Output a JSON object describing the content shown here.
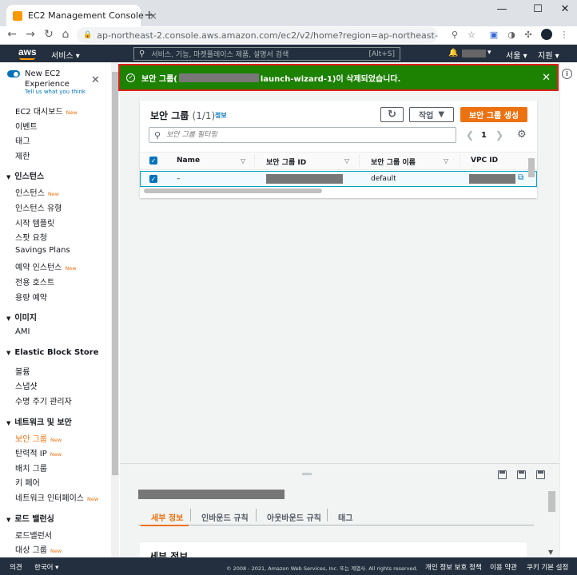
{
  "browser": {
    "tab_title": "EC2 Management Console",
    "tab_close": "×",
    "new_tab": "+",
    "url": "ap-northeast-2.console.aws.amazon.com/ec2/v2/home?region=ap-northeast-2#SecurityGroups:",
    "window_controls": [
      "—",
      "☐",
      "✕"
    ],
    "nav_icons": [
      "back-arrow",
      "forward-arrow",
      "reload",
      "lock"
    ]
  },
  "aws_header": {
    "logo": "aws",
    "services": "서비스 ▾",
    "search_placeholder": "서비스, 기능, 마켓플레이스 제품, 설명서 검색",
    "search_shortcut": "[Alt+S]",
    "region": "서울 ▾",
    "support": "지원 ▾"
  },
  "sidebar": {
    "new_experience": "New EC2 Experience",
    "new_experience_sub": "Tell us what you think",
    "new_badge": "New",
    "top_items": [
      {
        "label": "EC2 대시보드",
        "new": true
      },
      {
        "label": "이벤트",
        "new": false
      },
      {
        "label": "태그",
        "new": false
      },
      {
        "label": "제한",
        "new": false
      }
    ],
    "sections": [
      {
        "title": "인스턴스",
        "items": [
          {
            "label": "인스턴스",
            "new": true
          },
          {
            "label": "인스턴스 유형",
            "new": false
          },
          {
            "label": "시작 템플릿",
            "new": false
          },
          {
            "label": "스팟 요청",
            "new": false
          },
          {
            "label": "Savings Plans",
            "new": false
          },
          {
            "label": "예약 인스턴스",
            "new": true
          },
          {
            "label": "전용 호스트",
            "new": false
          },
          {
            "label": "용량 예약",
            "new": false
          }
        ]
      },
      {
        "title": "이미지",
        "items": [
          {
            "label": "AMI",
            "new": false
          }
        ]
      },
      {
        "title": "Elastic Block Store",
        "items": [
          {
            "label": "볼륨",
            "new": false
          },
          {
            "label": "스냅샷",
            "new": false
          },
          {
            "label": "수명 주기 관리자",
            "new": false
          }
        ]
      },
      {
        "title": "네트워크 및 보안",
        "items": [
          {
            "label": "보안 그룹",
            "new": true,
            "active": true
          },
          {
            "label": "탄력적 IP",
            "new": true
          },
          {
            "label": "배치 그룹",
            "new": false
          },
          {
            "label": "키 페어",
            "new": false
          },
          {
            "label": "네트워크 인터페이스",
            "new": true
          }
        ]
      },
      {
        "title": "로드 밸런싱",
        "items": [
          {
            "label": "로드밸런서",
            "new": false
          },
          {
            "label": "대상 그룹",
            "new": true
          }
        ]
      }
    ]
  },
  "flash": {
    "prefix": "보안 그룹(",
    "suffix": "launch-wizard-1)이 삭제되었습니다.",
    "close": "✕",
    "color": "#1d8102"
  },
  "panel": {
    "title": "보안 그룹",
    "count": "(1/1)",
    "info": "정보",
    "actions": "작업",
    "create": "보안 그룹 생성",
    "filter_placeholder": "보안 그룹 필터링",
    "page": "1",
    "columns": [
      "Name",
      "보안 그룹 ID",
      "보안 그룹 이름",
      "VPC ID"
    ],
    "rows": [
      {
        "name": "–",
        "group_name": "default"
      }
    ]
  },
  "details": {
    "tabs": [
      "세부 정보",
      "인바운드 규칙",
      "아웃바운드 규칙",
      "태그"
    ],
    "section_title": "세부 정보"
  },
  "footer": {
    "feedback": "의견",
    "language": "한국어 ▾",
    "copyright": "© 2008 - 2021, Amazon Web Services, Inc. 또는 계열사. All rights reserved.",
    "links": [
      "개인 정보 보호 정책",
      "이용 약관",
      "쿠키 기본 설정"
    ]
  },
  "colors": {
    "accent": "#ec7211",
    "link": "#0073bb",
    "header": "#232f3e"
  }
}
